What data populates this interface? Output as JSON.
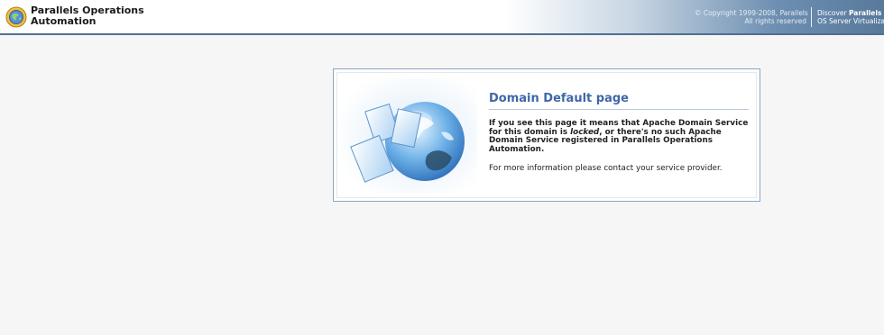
{
  "header": {
    "logo_icon": "parallels-logo-icon",
    "brand_line1": "Parallels Operations",
    "brand_line2": "Automation",
    "copyright_line1": "© Copyright 1999-2008, Parallels",
    "copyright_line2": "All rights reserved",
    "discover_prefix": "Discover ",
    "discover_brand": "Parallels",
    "discover_line2": "OS Server Virtualiza"
  },
  "panel": {
    "illustration_icon": "globe-documents-illustration",
    "title": "Domain Default page",
    "message_part1": "If you see this page it means that Apache Domain Service for this domain is ",
    "message_emph": "locked",
    "message_part2": ", or there's no such Apache Domain Service registered in Parallels Operations Automation.",
    "contact": "For more information please contact your service provider."
  },
  "colors": {
    "title_blue": "#3f67a7",
    "header_dark": "#58799b",
    "page_bg": "#f6f6f6"
  }
}
